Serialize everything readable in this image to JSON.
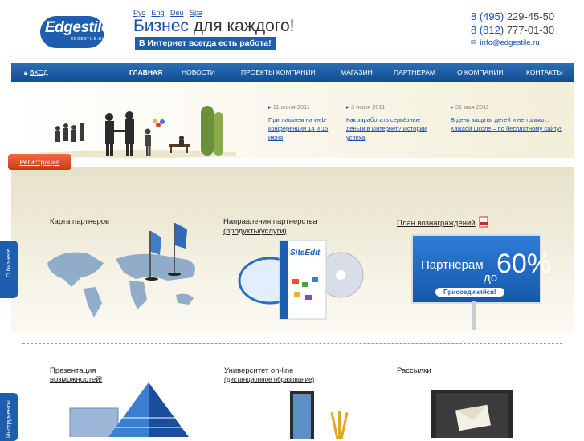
{
  "header": {
    "logo_text": "Edgestile",
    "logo_sub": "EDGESTILE.RU",
    "languages": [
      "Рус",
      "Eng",
      "Deu",
      "Spa"
    ],
    "slogan_highlight": "Бизнес",
    "slogan_rest": " для каждого!",
    "promo": "В Интернет всегда есть работа!",
    "phones": [
      {
        "prefix": "8 (495)",
        "number": " 229-45-50"
      },
      {
        "prefix": "8 (812)",
        "number": " 777-01-30"
      }
    ],
    "email": "info@edgestile.ru"
  },
  "nav": {
    "login": "ВХОД",
    "items": [
      "ГЛАВНАЯ",
      "НОВОСТИ",
      "ПРОЕКТЫ КОМПАНИИ",
      "МАГАЗИН",
      "ПАРТНЕРАМ",
      "О КОМПАНИИ",
      "КОНТАКТЫ"
    ]
  },
  "news": [
    {
      "date": "11 июня 2011",
      "text": "Приглашаем на web-конференции 14 и 15 июня"
    },
    {
      "date": "3 июня 2011",
      "text": "Как заработать серьёзные деньги в Интернет? Истории успеха"
    },
    {
      "date": "31 мая 2011",
      "text": "В день защиты детей и не только... Каждой школе – по бесплатному сайту!"
    }
  ],
  "register": "Регистрация",
  "partners": {
    "map_label": "Карта партнеров",
    "directions_label_1": "Направления партнерства",
    "directions_label_2": "(продукты/услуги)",
    "plan_label": "План вознаграждений",
    "billboard_line1": "Партнёрам",
    "billboard_do": "до",
    "billboard_percent": "60%",
    "billboard_join": "Присоединяйся!",
    "box_brand": "SiteEdit"
  },
  "sidetabs": {
    "about": "О бизнесе",
    "tools": "Инструменты"
  },
  "lower": {
    "presentation_1": "Презентация",
    "presentation_2": "возможностей!",
    "university_1": "Университет on-line",
    "university_2": "(дистанционное образование)",
    "mailing": "Рассылки"
  },
  "colors": {
    "brand": "#1d5fae",
    "accent": "#e8552a"
  }
}
